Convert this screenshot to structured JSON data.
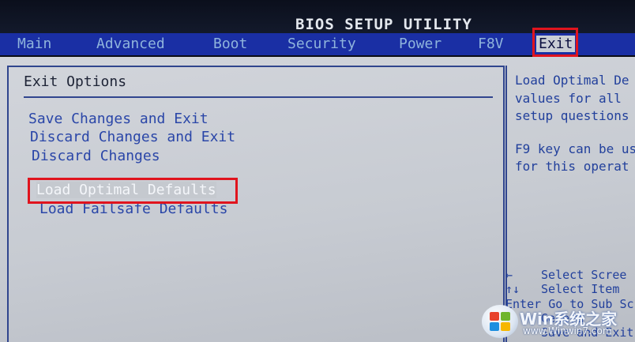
{
  "header": {
    "title": "BIOS SETUP UTILITY"
  },
  "menu": {
    "main": "Main",
    "advanced": "Advanced",
    "boot": "Boot",
    "security": "Security",
    "power": "Power",
    "f8v": "F8V",
    "exit": "Exit"
  },
  "exit_page": {
    "section_title": "Exit Options",
    "options": [
      "Save Changes and Exit",
      "Discard Changes and Exit",
      "Discard Changes",
      "Load Optimal Defaults",
      "Load Failsafe Defaults"
    ],
    "selected_option": "Load Optimal Defaults"
  },
  "help": {
    "lines": [
      "Load Optimal De",
      "values for all",
      "setup questions",
      "F9 key can be us",
      "for this operat"
    ],
    "keys": [
      {
        "key": "←",
        "desc": "Select Scree"
      },
      {
        "key": "↑↓",
        "desc": "Select Item"
      },
      {
        "key": "Enter",
        "desc": "Go to Sub Sc"
      },
      {
        "key": "",
        "desc": "Genera"
      },
      {
        "key": "",
        "desc": "Save and Exit"
      }
    ]
  },
  "watermark": {
    "text": "Win系统之家",
    "url": "www.Winwin7.com"
  },
  "colors": {
    "highlight_red": "#e0141e",
    "menu_blue": "#1a2fa4",
    "text_blue": "#2a46a8",
    "panel_gray": "#c9cdd4"
  }
}
